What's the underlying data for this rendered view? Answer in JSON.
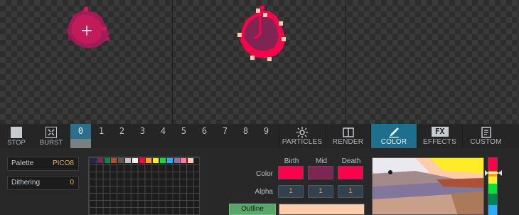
{
  "toolbar": {
    "stop_label": "STOP",
    "burst_label": "BURST",
    "frames": [
      "0",
      "1",
      "2",
      "3",
      "4",
      "5",
      "6",
      "7",
      "8",
      "9"
    ],
    "active_frame": "0",
    "modes": [
      {
        "key": "particles",
        "label": "PARTICLES",
        "icon": "sun-icon"
      },
      {
        "key": "render",
        "label": "RENDER",
        "icon": "book-icon"
      },
      {
        "key": "color",
        "label": "COLOR",
        "icon": "brush-icon"
      },
      {
        "key": "effects",
        "label": "EFFECTS",
        "icon": "fx-icon",
        "icon_text": "FX"
      },
      {
        "key": "custom",
        "label": "CUSTOM",
        "icon": "document-icon"
      }
    ],
    "active_mode": "color"
  },
  "settings": {
    "palette_label": "Palette",
    "palette_value": "PICO8",
    "dithering_label": "Dithering",
    "dithering_value": "0"
  },
  "palette_colors": [
    "#1d2b53",
    "#7e2553",
    "#008751",
    "#ab5236",
    "#5f574f",
    "#c2c3c7",
    "#fff1e8",
    "#ff004d",
    "#ffa300",
    "#ffec27",
    "#00e436",
    "#29adff",
    "#83769c",
    "#ff77a8",
    "#ffccaa"
  ],
  "color_panel": {
    "headers": {
      "birth": "Birth",
      "mid": "Mid",
      "death": "Death"
    },
    "color_row_label": "Color",
    "alpha_row_label": "Alpha",
    "birth_color": "#ff004d",
    "mid_color": "#7e2553",
    "death_color": "#ff004d",
    "birth_alpha": "1",
    "mid_alpha": "1",
    "death_alpha": "1",
    "outline_label": "Outline",
    "outline_color": "#ffccaa"
  },
  "accent_color": "#1e6e8d"
}
